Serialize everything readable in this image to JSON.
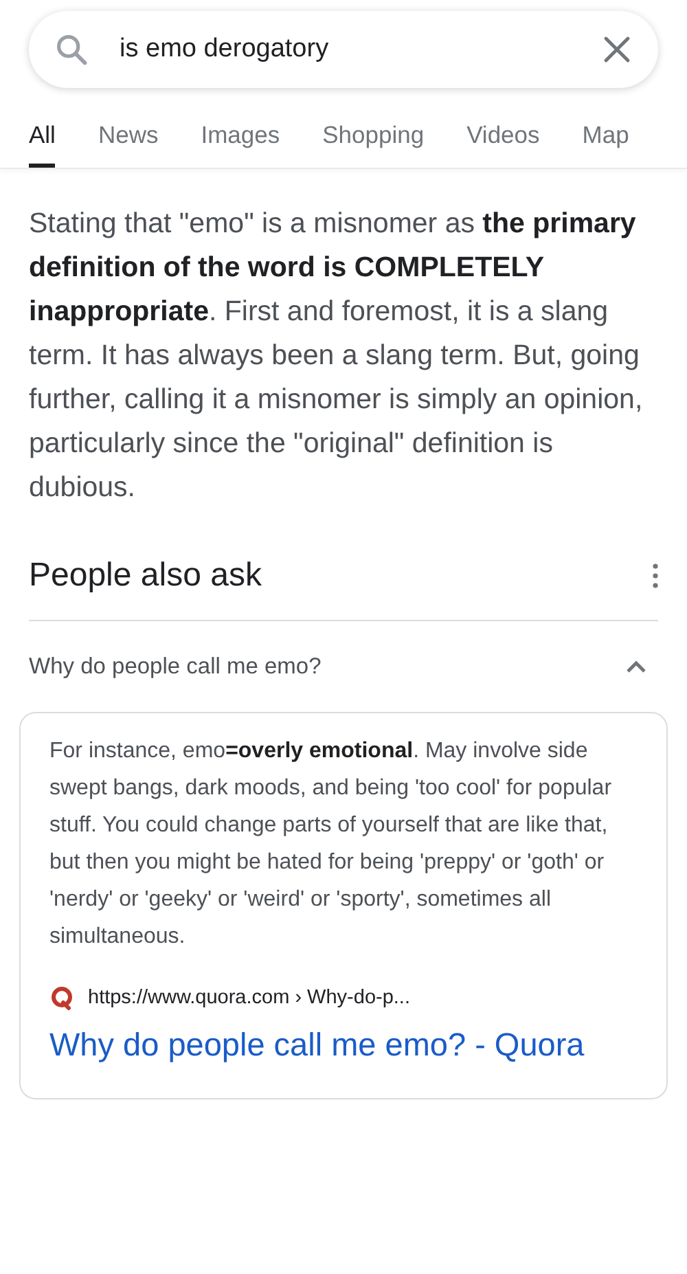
{
  "search": {
    "value": "is emo derogatory"
  },
  "tabs": [
    {
      "label": "All",
      "selected": true
    },
    {
      "label": "News",
      "selected": false
    },
    {
      "label": "Images",
      "selected": false
    },
    {
      "label": "Shopping",
      "selected": false
    },
    {
      "label": "Videos",
      "selected": false
    },
    {
      "label": "Map",
      "selected": false
    }
  ],
  "snippet": "Stating that \"emo\" is a misnomer as **the primary definition of the word is COMPLETELY inappropriate**. First and foremost, it is a slang term. It has always been a slang term. But, going further, calling it a misnomer is simply an opinion, particularly since the \"original\" definition is dubious.",
  "people_also_ask": {
    "title": "People also ask",
    "questions": [
      {
        "question": "Why do people call me emo?",
        "expanded": true,
        "answer": "For instance, emo**=overly emotional**. May involve side swept bangs, dark moods, and being 'too cool' for popular stuff. You could change parts of yourself that are like that, but then you might be hated for being 'preppy' or 'goth' or 'nerdy' or 'geeky' or 'weird' or 'sporty', sometimes all simultaneous.",
        "source_url": "https://www.quora.com › Why-do-p...",
        "link_title": "Why do people call me emo? - Quora"
      }
    ]
  }
}
